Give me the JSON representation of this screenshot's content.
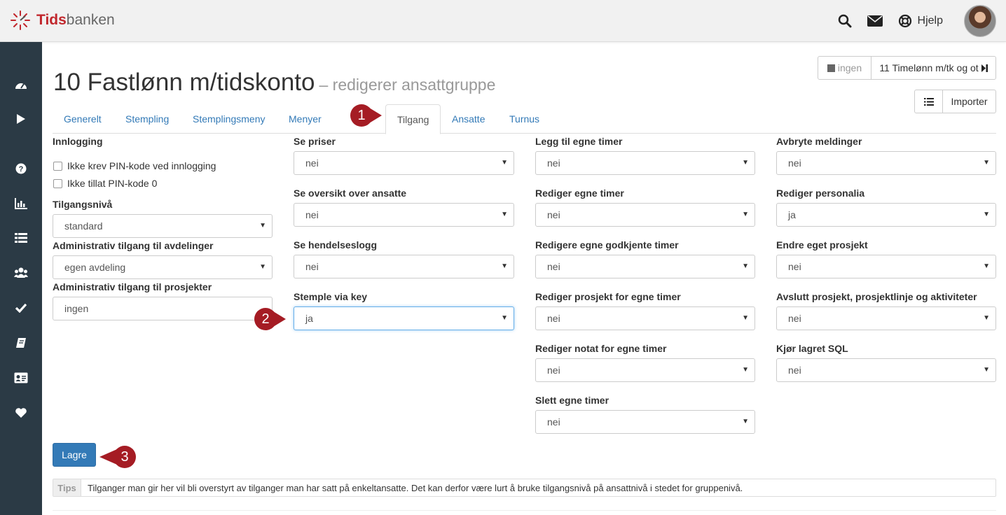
{
  "brand": {
    "name_part1": "Tids",
    "name_part2": "banken"
  },
  "topbar": {
    "help_label": "Hjelp"
  },
  "title": {
    "main": "10 Fastlønn m/tidskonto",
    "sub": "– redigerer ansattgruppe"
  },
  "nav_buttons": {
    "prev_label": "ingen",
    "next_label": "11 Timelønn m/tk og ot",
    "import_label": "Importer"
  },
  "tabs": [
    "Generelt",
    "Stempling",
    "Stemplingsmeny",
    "Menyer",
    "Tilgang",
    "Ansatte",
    "Turnus"
  ],
  "column1": {
    "login_heading": "Innlogging",
    "checkbox1_label": "Ikke krev PIN-kode ved innlogging",
    "checkbox2_label": "Ikke tillat PIN-kode 0",
    "access_level_label": "Tilgangsnivå",
    "access_level_value": "standard",
    "admin_dept_label": "Administrativ tilgang til avdelinger",
    "admin_dept_value": "egen avdeling",
    "admin_proj_label": "Administrativ tilgang til prosjekter",
    "admin_proj_value": "ingen"
  },
  "column2": [
    {
      "label": "Se priser",
      "value": "nei"
    },
    {
      "label": "Se oversikt over ansatte",
      "value": "nei"
    },
    {
      "label": "Se hendelseslogg",
      "value": "nei"
    },
    {
      "label": "Stemple via key",
      "value": "ja"
    }
  ],
  "column3": [
    {
      "label": "Legg til egne timer",
      "value": "nei"
    },
    {
      "label": "Rediger egne timer",
      "value": "nei"
    },
    {
      "label": "Redigere egne godkjente timer",
      "value": "nei"
    },
    {
      "label": "Rediger prosjekt for egne timer",
      "value": "nei"
    },
    {
      "label": "Rediger notat for egne timer",
      "value": "nei"
    },
    {
      "label": "Slett egne timer",
      "value": "nei"
    }
  ],
  "column4": [
    {
      "label": "Avbryte meldinger",
      "value": "nei"
    },
    {
      "label": "Rediger personalia",
      "value": "ja"
    },
    {
      "label": "Endre eget prosjekt",
      "value": "nei"
    },
    {
      "label": "Avslutt prosjekt, prosjektlinje og aktiviteter",
      "value": "nei"
    },
    {
      "label": "Kjør lagret SQL",
      "value": "nei"
    }
  ],
  "save_label": "Lagre",
  "tips": {
    "label": "Tips",
    "text": "Tilganger man gir her vil bli overstyrt av tilganger man har satt på enkeltansatte. Det kan derfor være lurt å bruke tilgangsnivå på ansattnivå i stedet for gruppenivå."
  },
  "markers": [
    "1",
    "2",
    "3"
  ],
  "colors": {
    "accent": "#337ab7",
    "brand_red": "#c1272d",
    "sidebar": "#2b3a45",
    "marker": "#a51c24"
  }
}
